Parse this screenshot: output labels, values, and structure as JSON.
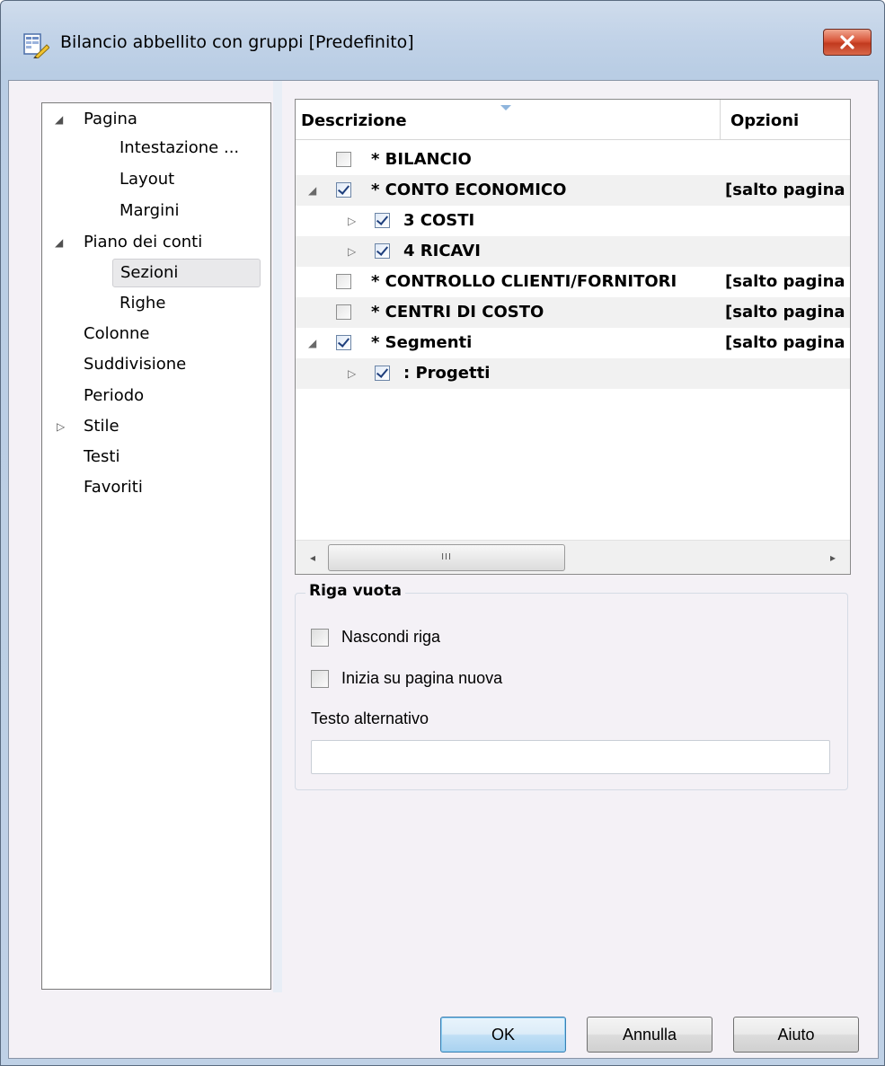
{
  "window": {
    "title": "Bilancio abbellito con gruppi [Predefinito]"
  },
  "nav": {
    "items": [
      {
        "label": "Pagina",
        "arrow": "◢"
      },
      {
        "label": "Intestazione ..."
      },
      {
        "label": "Layout"
      },
      {
        "label": "Margini"
      },
      {
        "label": "Piano dei conti",
        "arrow": "◢"
      },
      {
        "label": "Sezioni"
      },
      {
        "label": "Righe"
      },
      {
        "label": "Colonne"
      },
      {
        "label": "Suddivisione"
      },
      {
        "label": "Periodo"
      },
      {
        "label": "Stile",
        "arrow": "▷"
      },
      {
        "label": "Testi"
      },
      {
        "label": "Favoriti"
      }
    ]
  },
  "grid": {
    "col_descrizione": "Descrizione",
    "col_opzioni": "Opzioni",
    "rows": [
      {
        "text": "* BILANCIO",
        "opt": "",
        "checked": false
      },
      {
        "text": "* CONTO ECONOMICO",
        "opt": "[salto pagina",
        "checked": true,
        "expander": "◢"
      },
      {
        "text": "3 COSTI",
        "opt": "",
        "checked": true,
        "expander": "▷"
      },
      {
        "text": "4 RICAVI",
        "opt": "",
        "checked": true,
        "expander": "▷"
      },
      {
        "text": "* CONTROLLO CLIENTI/FORNITORI",
        "opt": "[salto pagina",
        "checked": false
      },
      {
        "text": "* CENTRI DI COSTO",
        "opt": "[salto pagina",
        "checked": false
      },
      {
        "text": "* Segmenti",
        "opt": "[salto pagina",
        "checked": true,
        "expander": "◢"
      },
      {
        "text": ": Progetti",
        "opt": "",
        "checked": true,
        "expander": "▷"
      }
    ],
    "scroll_thumb": "III",
    "scroll_left": "◂",
    "scroll_right": "▸"
  },
  "riga_vuota": {
    "title": "Riga vuota",
    "hide_row": "Nascondi riga",
    "new_page": "Inizia su pagina nuova",
    "alt_text_label": "Testo alternativo",
    "alt_text_value": ""
  },
  "buttons": {
    "ok": "OK",
    "cancel": "Annulla",
    "help": "Aiuto"
  },
  "colors": {
    "accent": "#3c7fb1",
    "close": "#c23a1e"
  }
}
